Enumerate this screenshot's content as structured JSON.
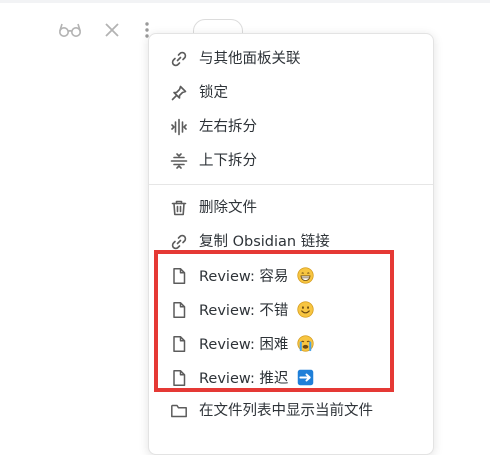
{
  "colors": {
    "menu_text": "#2e3338",
    "icon_gray": "#5c5c5c",
    "highlight_red": "#e53935",
    "topbar_icon": "#b3b3b3"
  },
  "topbar": {
    "icons": [
      "reading-view-icon",
      "close-icon",
      "more-options-icon"
    ]
  },
  "menu": {
    "groups": [
      {
        "items": [
          {
            "icon": "link-icon",
            "label": "与其他面板关联"
          },
          {
            "icon": "pin-icon",
            "label": "锁定"
          },
          {
            "icon": "split-vertical-icon",
            "label": "左右拆分"
          },
          {
            "icon": "split-horizontal-icon",
            "label": "上下拆分"
          }
        ]
      },
      {
        "items": [
          {
            "icon": "trash-icon",
            "label": "删除文件"
          },
          {
            "icon": "link-icon",
            "label": "复制 Obsidian 链接"
          },
          {
            "icon": "file-icon",
            "label": "Review: 容易",
            "emoji": "grinning-face"
          },
          {
            "icon": "file-icon",
            "label": "Review: 不错",
            "emoji": "smiling-face"
          },
          {
            "icon": "file-icon",
            "label": "Review: 困难",
            "emoji": "crying-face"
          },
          {
            "icon": "file-icon",
            "label": "Review: 推迟",
            "emoji": "right-arrow"
          },
          {
            "icon": "folder-icon",
            "label": "在文件列表中显示当前文件"
          }
        ]
      }
    ]
  }
}
